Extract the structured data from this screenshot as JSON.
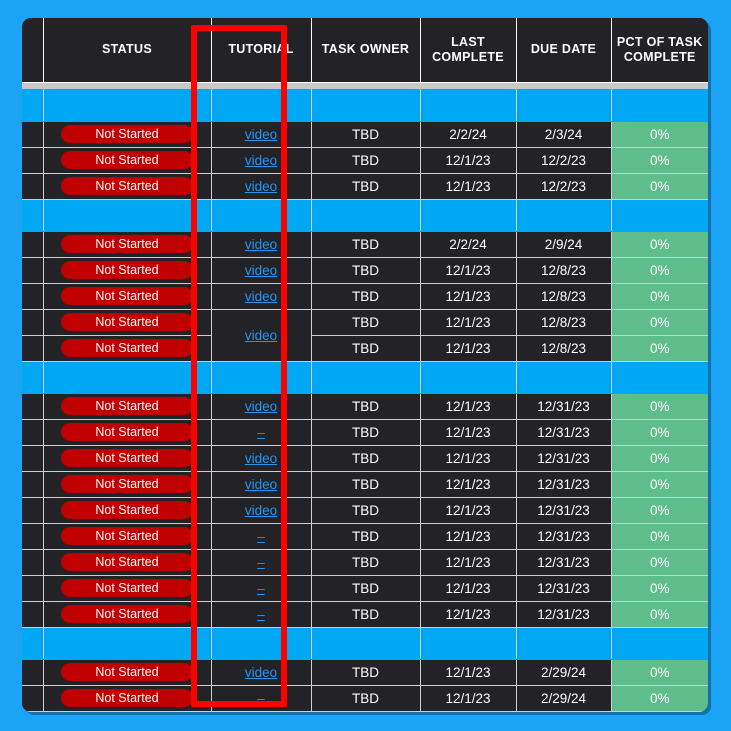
{
  "table": {
    "columns": [
      {
        "key": "tag",
        "label": ""
      },
      {
        "key": "status",
        "label": "STATUS"
      },
      {
        "key": "tutorial",
        "label": "TUTORIAL"
      },
      {
        "key": "owner",
        "label": "TASK OWNER"
      },
      {
        "key": "last",
        "label": "LAST COMPLETE"
      },
      {
        "key": "due",
        "label": "DUE DATE"
      },
      {
        "key": "pct",
        "label": "PCT OF TASK COMPLETE"
      }
    ],
    "header": {
      "status": "STATUS",
      "tutorial": "TUTORIAL",
      "owner": "TASK OWNER",
      "last_line1": "LAST",
      "last_line2": "COMPLETE",
      "due": "DUE DATE",
      "pct_line1": "PCT OF TASK",
      "pct_line2": "COMPLETE"
    },
    "labels": {
      "status_not_started": "Not Started",
      "tutorial_link": "video",
      "tutorial_none": "–",
      "owner_tbd": "TBD",
      "pct_zero": "0%"
    },
    "groups": [
      {
        "rows": [
          {
            "status": "Not Started",
            "tutorial": "video",
            "owner": "TBD",
            "last": "2/2/24",
            "due": "2/3/24",
            "pct": "0%"
          },
          {
            "status": "Not Started",
            "tutorial": "video",
            "owner": "TBD",
            "last": "12/1/23",
            "due": "12/2/23",
            "pct": "0%"
          },
          {
            "status": "Not Started",
            "tutorial": "video",
            "owner": "TBD",
            "last": "12/1/23",
            "due": "12/2/23",
            "pct": "0%"
          }
        ]
      },
      {
        "rows": [
          {
            "status": "Not Started",
            "tutorial": "video",
            "owner": "TBD",
            "last": "2/2/24",
            "due": "2/9/24",
            "pct": "0%"
          },
          {
            "status": "Not Started",
            "tutorial": "video",
            "owner": "TBD",
            "last": "12/1/23",
            "due": "12/8/23",
            "pct": "0%"
          },
          {
            "status": "Not Started",
            "tutorial": "video",
            "owner": "TBD",
            "last": "12/1/23",
            "due": "12/8/23",
            "pct": "0%"
          },
          {
            "status": "Not Started",
            "tutorial": "video",
            "owner": "TBD",
            "last": "12/1/23",
            "due": "12/8/23",
            "pct": "0%",
            "tutorial_merged_start": true,
            "tutorial_span": 2
          },
          {
            "status": "Not Started",
            "tutorial": "",
            "owner": "TBD",
            "last": "12/1/23",
            "due": "12/8/23",
            "pct": "0%",
            "tutorial_hidden": true
          }
        ]
      },
      {
        "rows": [
          {
            "status": "Not Started",
            "tutorial": "video",
            "owner": "TBD",
            "last": "12/1/23",
            "due": "12/31/23",
            "pct": "0%"
          },
          {
            "status": "Not Started",
            "tutorial": "–",
            "owner": "TBD",
            "last": "12/1/23",
            "due": "12/31/23",
            "pct": "0%"
          },
          {
            "status": "Not Started",
            "tutorial": "video",
            "owner": "TBD",
            "last": "12/1/23",
            "due": "12/31/23",
            "pct": "0%"
          },
          {
            "status": "Not Started",
            "tutorial": "video",
            "owner": "TBD",
            "last": "12/1/23",
            "due": "12/31/23",
            "pct": "0%"
          },
          {
            "status": "Not Started",
            "tutorial": "video",
            "owner": "TBD",
            "last": "12/1/23",
            "due": "12/31/23",
            "pct": "0%"
          },
          {
            "status": "Not Started",
            "tutorial": "–",
            "owner": "TBD",
            "last": "12/1/23",
            "due": "12/31/23",
            "pct": "0%"
          },
          {
            "status": "Not Started",
            "tutorial": "–",
            "owner": "TBD",
            "last": "12/1/23",
            "due": "12/31/23",
            "pct": "0%"
          },
          {
            "status": "Not Started",
            "tutorial": "–",
            "owner": "TBD",
            "last": "12/1/23",
            "due": "12/31/23",
            "pct": "0%"
          },
          {
            "status": "Not Started",
            "tutorial": "–",
            "owner": "TBD",
            "last": "12/1/23",
            "due": "12/31/23",
            "pct": "0%"
          }
        ]
      },
      {
        "rows": [
          {
            "status": "Not Started",
            "tutorial": "video",
            "owner": "TBD",
            "last": "12/1/23",
            "due": "2/29/24",
            "pct": "0%"
          },
          {
            "status": "Not Started",
            "tutorial": "–",
            "owner": "TBD",
            "last": "12/1/23",
            "due": "2/29/24",
            "pct": "0%"
          }
        ]
      }
    ]
  },
  "annotation": {
    "highlight_column": "TUTORIAL",
    "highlight_color": "#ff0000"
  },
  "colors": {
    "page_background": "#1ba3f5",
    "table_background": "#232327",
    "separator_blue": "#00a8f3",
    "status_pill_red": "#c00000",
    "pct_green": "#5ebd8a",
    "link_blue": "#2196f3",
    "grid_line": "#cfcfcf",
    "header_rule": "#c9c9c9"
  }
}
